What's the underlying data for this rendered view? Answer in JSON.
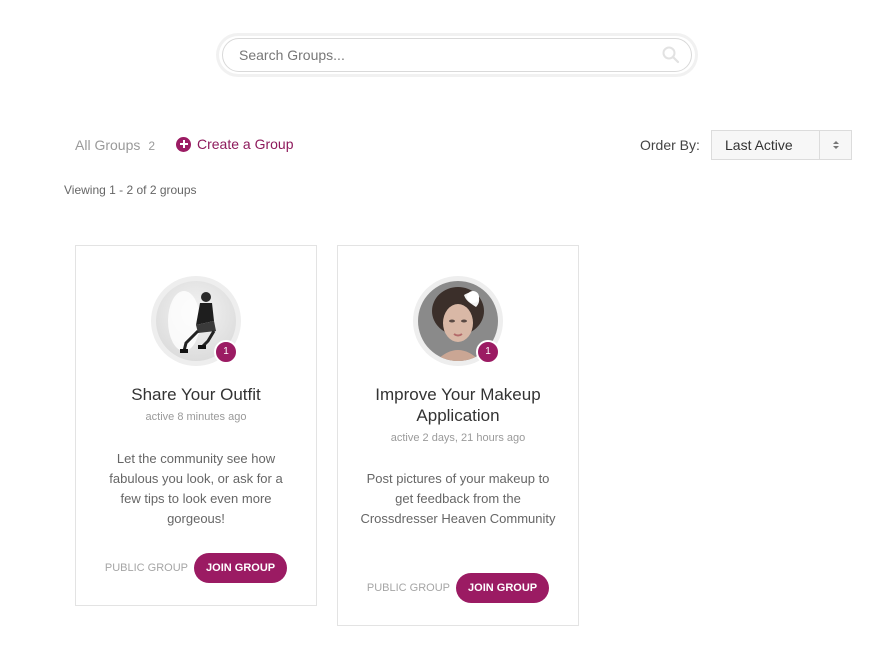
{
  "search": {
    "placeholder": "Search Groups..."
  },
  "filters": {
    "all_groups_label": "All Groups",
    "all_groups_count": "2",
    "create_group_label": "Create a Group"
  },
  "order": {
    "label": "Order By:",
    "selected": "Last Active"
  },
  "viewing_text": "Viewing 1 - 2 of 2 groups",
  "colors": {
    "accent": "#9b1b63"
  },
  "groups": [
    {
      "title": "Share Your Outfit",
      "active": "active 8 minutes ago",
      "description": "Let the community see how fabulous you look, or ask for a few tips to look even more gorgeous!",
      "member_count": "1",
      "type": "PUBLIC GROUP",
      "join_label": "JOIN GROUP",
      "avatar_icon": "group-avatar-fashion-photo"
    },
    {
      "title": "Improve Your Makeup Application",
      "active": "active 2 days, 21 hours ago",
      "description": "Post pictures of your makeup to get feedback from the Crossdresser Heaven Community",
      "member_count": "1",
      "type": "PUBLIC GROUP",
      "join_label": "JOIN GROUP",
      "avatar_icon": "group-avatar-portrait-photo"
    }
  ]
}
